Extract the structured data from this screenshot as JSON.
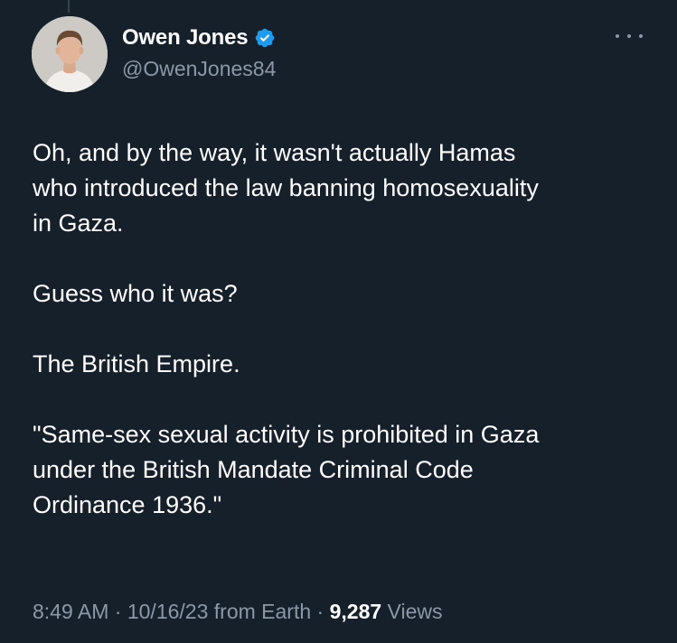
{
  "author": {
    "display_name": "Owen Jones",
    "handle": "@OwenJones84",
    "verified": true,
    "avatar": "profile-photo"
  },
  "tweet": {
    "paragraphs": [
      "Oh, and by the way, it wasn't actually Hamas\nwho introduced the law banning homosexuality\nin Gaza.",
      "Guess who it was?",
      "The British Empire.",
      "\"Same-sex sexual activity is prohibited in Gaza\nunder the British Mandate Criminal Code\nOrdinance 1936.\""
    ]
  },
  "meta": {
    "time": "8:49 AM",
    "sep1": " · ",
    "date": "10/16/23",
    "source": " from Earth",
    "sep2": " · ",
    "views_count": "9,287",
    "views_label": " Views"
  },
  "icons": {
    "verified": "verified-badge-icon",
    "more": "more-options-icon"
  },
  "colors": {
    "background": "#15202b",
    "text": "#ffffff",
    "secondary_text": "#8b98a5",
    "verified_blue": "#1d9bf0"
  }
}
